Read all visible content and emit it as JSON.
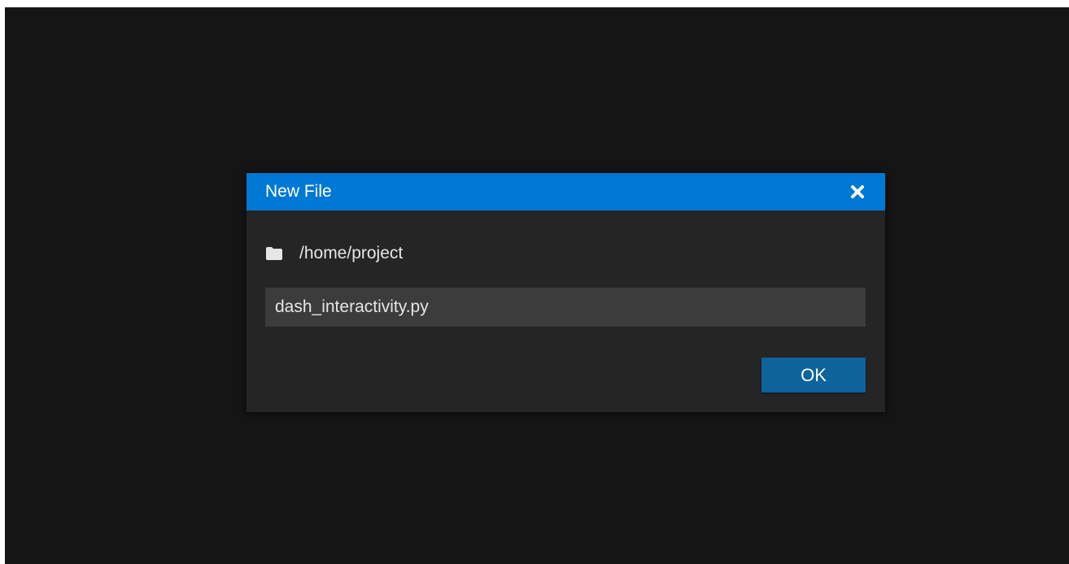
{
  "dialog": {
    "title": "New File",
    "close_icon": "close-x-icon",
    "folder_icon": "folder-icon",
    "path": "/home/project",
    "filename_value": "dash_interactivity.py",
    "ok_label": "OK"
  },
  "colors": {
    "background": "#151515",
    "dialog_body": "#252526",
    "titlebar": "#0078d4",
    "input_background": "#3c3c3c",
    "ok_button": "#0e639c",
    "text": "#e6e6e6"
  }
}
